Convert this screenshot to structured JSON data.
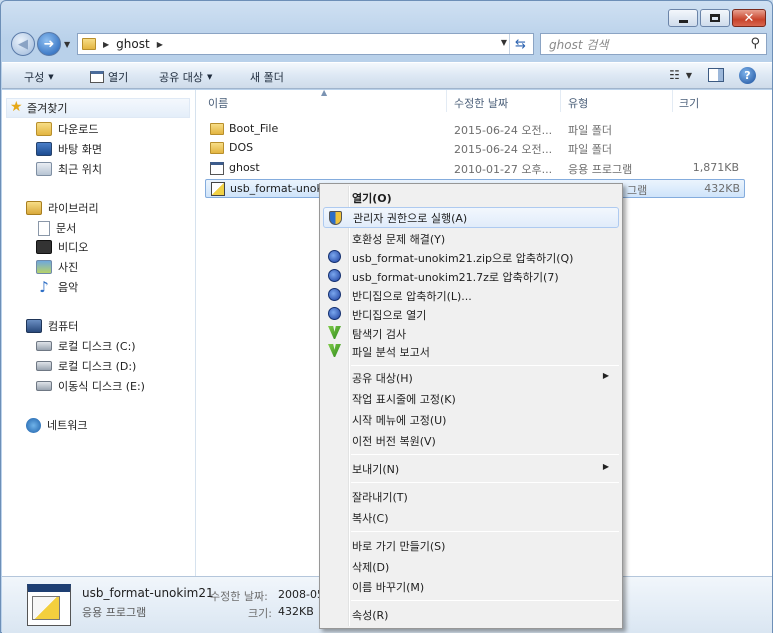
{
  "window": {
    "title_buttons": {
      "minimize": "minimize-icon",
      "maximize": "maximize-icon",
      "close": "close-icon"
    }
  },
  "address": {
    "crumb": "ghost",
    "search_placeholder": "ghost 검색"
  },
  "toolbar": {
    "organize": "구성",
    "open": "열기",
    "share": "공유 대상",
    "new_folder": "새 폴더"
  },
  "navpane": {
    "favorites": "즐겨찾기",
    "downloads": "다운로드",
    "desktop": "바탕 화면",
    "recent": "최근 위치",
    "libraries": "라이브러리",
    "documents": "문서",
    "videos": "비디오",
    "pictures": "사진",
    "music": "음악",
    "computer": "컴퓨터",
    "local_c": "로컬 디스크 (C:)",
    "local_d": "로컬 디스크 (D:)",
    "removable_e": "이동식 디스크 (E:)",
    "network": "네트워크"
  },
  "filelist": {
    "columns": {
      "name": "이름",
      "date": "수정한 날짜",
      "type": "유형",
      "size": "크기"
    },
    "rows": [
      {
        "name": "Boot_File",
        "date": "2015-06-24 오전...",
        "type": "파일 폴더",
        "size": ""
      },
      {
        "name": "DOS",
        "date": "2015-06-24 오전...",
        "type": "파일 폴더",
        "size": ""
      },
      {
        "name": "ghost",
        "date": "2010-01-27 오후...",
        "type": "응용 프로그램",
        "size": "1,871KB"
      },
      {
        "name": "usb_format-unokim21",
        "date": "",
        "type": "그램",
        "size": "432KB"
      }
    ]
  },
  "details": {
    "name": "usb_format-unokim21",
    "type": "응용 프로그램",
    "modified_label": "수정한 날짜:",
    "modified_value": "2008-05",
    "size_label": "크기:",
    "size_value": "432KB"
  },
  "context_menu": {
    "items": [
      {
        "label": "열기(O)"
      },
      {
        "label": "관리자 권한으로 실행(A)"
      },
      {
        "label": "호환성 문제 해결(Y)"
      },
      {
        "label": "usb_format-unokim21.zip으로 압축하기(Q)"
      },
      {
        "label": "usb_format-unokim21.7z로 압축하기(7)"
      },
      {
        "label": "반디집으로 압축하기(L)..."
      },
      {
        "label": "반디집으로 열기"
      },
      {
        "label": "탐색기 검사"
      },
      {
        "label": "파일 분석 보고서"
      },
      {
        "label": "공유 대상(H)"
      },
      {
        "label": "작업 표시줄에 고정(K)"
      },
      {
        "label": "시작 메뉴에 고정(U)"
      },
      {
        "label": "이전 버전 복원(V)"
      },
      {
        "label": "보내기(N)"
      },
      {
        "label": "잘라내기(T)"
      },
      {
        "label": "복사(C)"
      },
      {
        "label": "바로 가기 만들기(S)"
      },
      {
        "label": "삭제(D)"
      },
      {
        "label": "이름 바꾸기(M)"
      },
      {
        "label": "속성(R)"
      }
    ]
  },
  "colors": {
    "selection": "#cfe4fa",
    "menu_bg": "#f0f0f0",
    "chrome": "#bcd3ec"
  }
}
